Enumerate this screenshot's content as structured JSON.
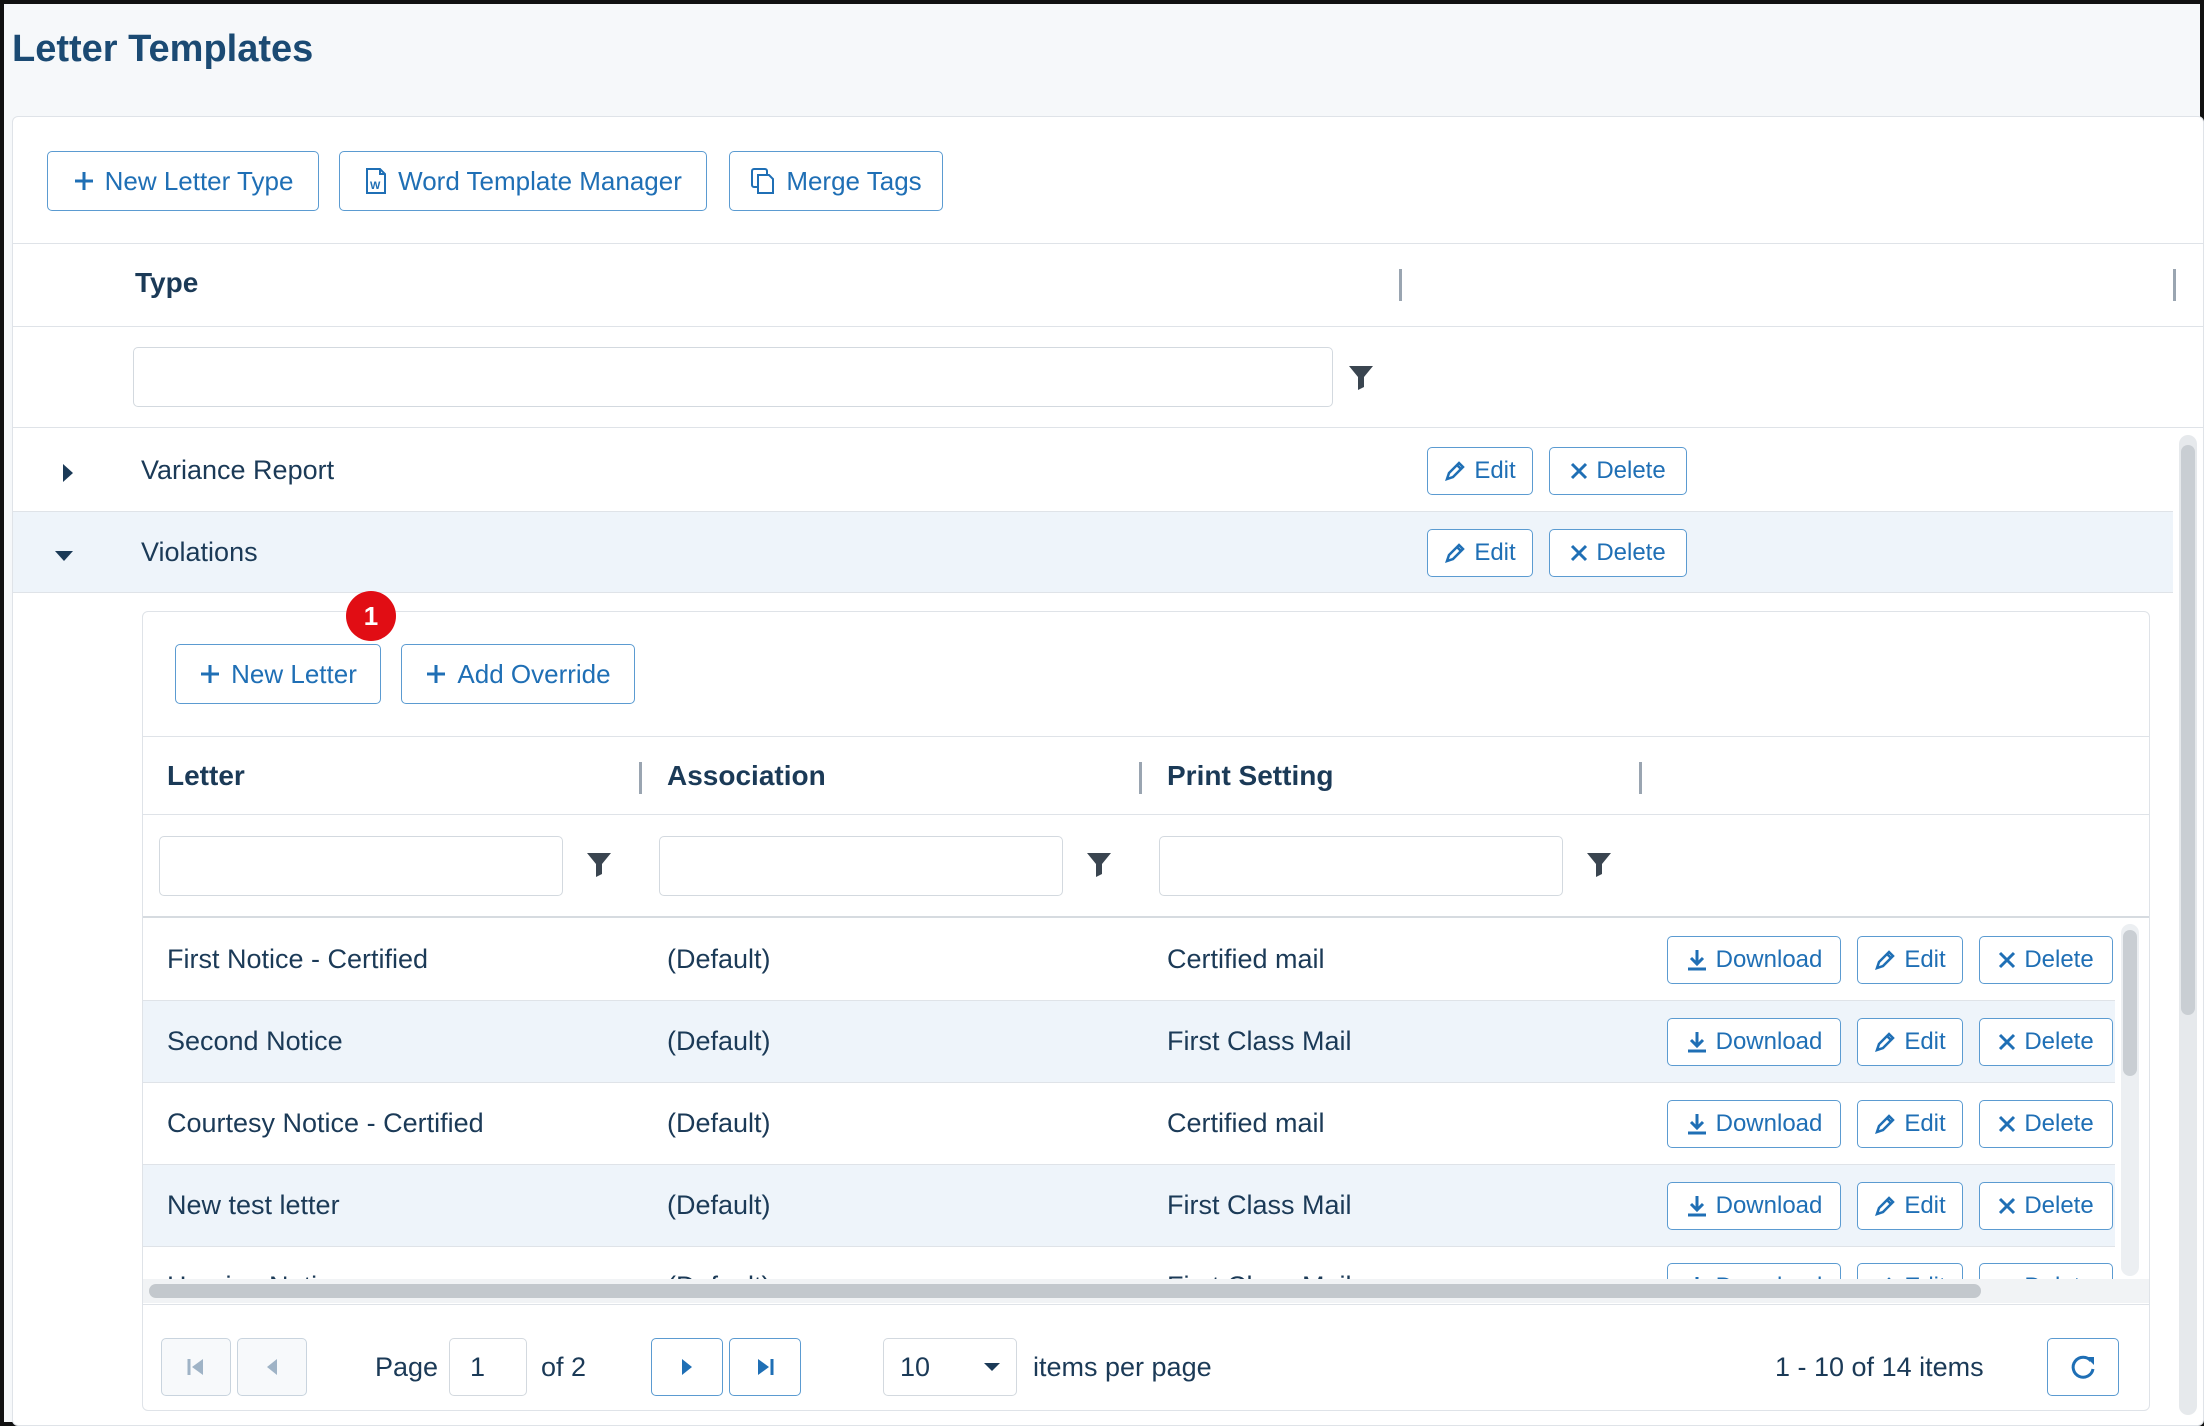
{
  "page": {
    "title": "Letter Templates"
  },
  "toolbar": {
    "new_letter_type": "New Letter Type",
    "word_template_manager": "Word Template Manager",
    "merge_tags": "Merge Tags"
  },
  "outer_grid": {
    "column_type": "Type",
    "rows": [
      {
        "type": "Variance Report",
        "expanded": false,
        "edit": "Edit",
        "delete": "Delete"
      },
      {
        "type": "Violations",
        "expanded": true,
        "edit": "Edit",
        "delete": "Delete"
      }
    ]
  },
  "detail": {
    "badge": "1",
    "new_letter": "New Letter",
    "add_override": "Add Override",
    "columns": {
      "letter": "Letter",
      "association": "Association",
      "print_setting": "Print Setting"
    },
    "actions": {
      "download": "Download",
      "edit": "Edit",
      "delete": "Delete"
    },
    "rows": [
      {
        "letter": "First Notice - Certified",
        "association": "(Default)",
        "print_setting": "Certified mail"
      },
      {
        "letter": "Second Notice",
        "association": "(Default)",
        "print_setting": "First Class Mail"
      },
      {
        "letter": "Courtesy Notice - Certified",
        "association": "(Default)",
        "print_setting": "Certified mail"
      },
      {
        "letter": "New test letter",
        "association": "(Default)",
        "print_setting": "First Class Mail"
      },
      {
        "letter": "Hearing Notice",
        "association": "(Default)",
        "print_setting": "First Class Mail"
      }
    ],
    "pager": {
      "page_label": "Page",
      "current_page": "1",
      "of_label": "of 2",
      "page_size": "10",
      "items_per_page_label": "items per page",
      "summary": "1 - 10 of 14 items"
    }
  },
  "colors": {
    "accent": "#1f6fb5",
    "title": "#1b4a73",
    "badge": "#e10d14",
    "alt_row": "#eef4fa"
  },
  "icons": [
    "plus-icon",
    "word-doc-icon",
    "copy-icon",
    "filter-icon",
    "pencil-icon",
    "close-icon",
    "download-icon",
    "caret-right-icon",
    "caret-down-icon",
    "first-page-icon",
    "prev-page-icon",
    "next-page-icon",
    "last-page-icon",
    "refresh-icon",
    "dropdown-caret-icon"
  ]
}
